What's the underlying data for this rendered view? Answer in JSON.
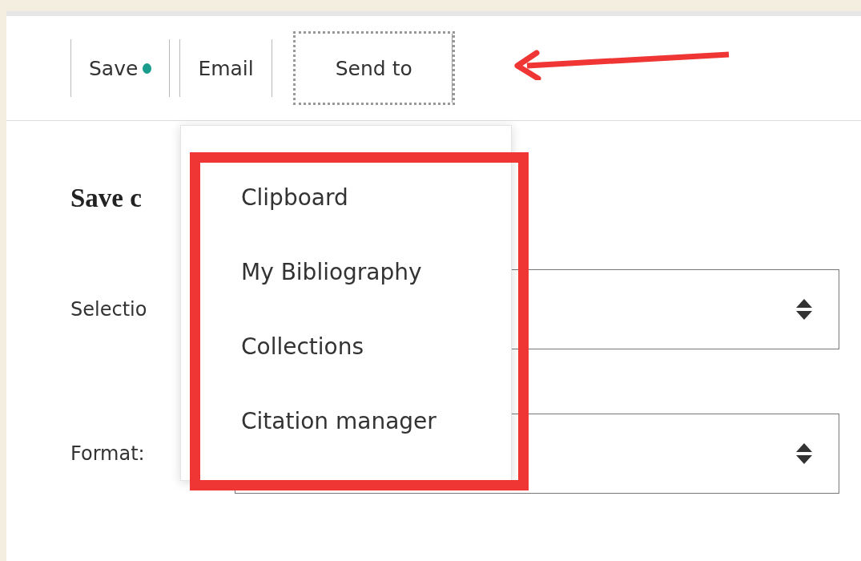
{
  "toolbar": [
    {
      "label": "Save",
      "status_dot": true,
      "selected": false
    },
    {
      "label": "Email",
      "status_dot": false,
      "selected": false
    },
    {
      "label": "Send to",
      "status_dot": false,
      "selected": true
    }
  ],
  "form": {
    "heading": "Save c",
    "fields": [
      {
        "label": "Selectio"
      },
      {
        "label": "Format:"
      }
    ]
  },
  "send_to_menu": {
    "items": [
      "Clipboard",
      "My Bibliography",
      "Collections",
      "Citation manager"
    ]
  }
}
